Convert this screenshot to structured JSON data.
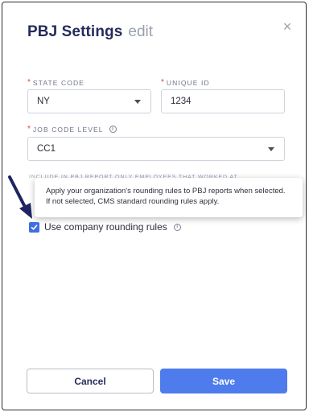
{
  "modal": {
    "title": "PBJ Settings",
    "subtitle": "edit",
    "close_glyph": "×"
  },
  "fields": {
    "state_code": {
      "label": "STATE CODE",
      "required_mark": "*",
      "value": "NY"
    },
    "unique_id": {
      "label": "UNIQUE ID",
      "required_mark": "*",
      "value": "1234"
    },
    "job_code_level": {
      "label": "JOB CODE LEVEL",
      "required_mark": "*",
      "value": "CC1",
      "info_glyph": "i"
    }
  },
  "partial_label": "INCLUDE IN PBJ REPORT ONLY EMPLOYEES THAT WORKED AT",
  "tooltip": {
    "text": "Apply your organization's rounding rules to PBJ reports when selected. If not selected, CMS standard rounding rules apply."
  },
  "rounding": {
    "label": "Use company rounding rules",
    "checked": true,
    "info_glyph": "i"
  },
  "buttons": {
    "cancel": "Cancel",
    "save": "Save"
  },
  "colors": {
    "title": "#262b5c",
    "primary": "#4f7cec",
    "checkbox": "#3f6fe0",
    "required": "#e2403f",
    "annotation_arrow": "#1e2460"
  },
  "icons": [
    "close-icon",
    "chevron-down-icon",
    "info-icon",
    "checkmark-icon",
    "annotation-arrow-icon"
  ]
}
